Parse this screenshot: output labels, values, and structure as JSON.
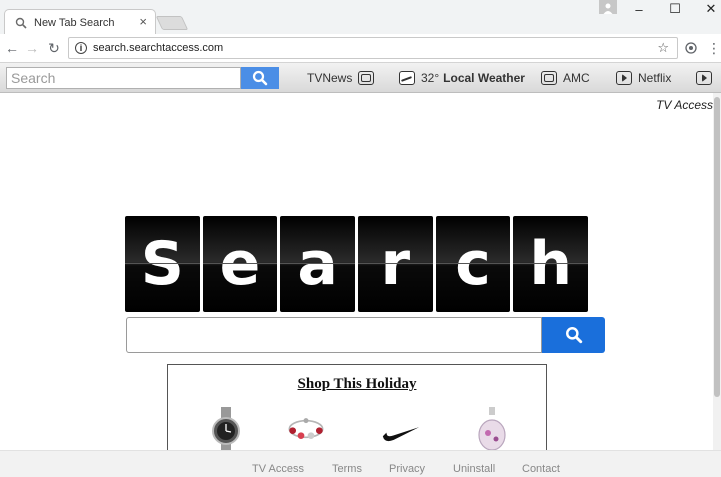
{
  "browser": {
    "tab_title": "New Tab Search",
    "tab_close": "×",
    "url": "search.searchtaccess.com",
    "window": {
      "minimize": "–",
      "maximize": "☐",
      "close": "✕"
    }
  },
  "toolbar": {
    "search_placeholder": "Search",
    "links": {
      "tvnews": "TVNews",
      "weather_temp": "32°",
      "weather_label": "Local Weather",
      "amc": "AMC",
      "netflix": "Netflix"
    }
  },
  "brand": "TV Access",
  "logo_letters": [
    "S",
    "e",
    "a",
    "r",
    "c",
    "h"
  ],
  "promo": {
    "title": "Shop This Holiday"
  },
  "footer": {
    "links": [
      "TV Access",
      "Terms",
      "Privacy",
      "Uninstall",
      "Contact"
    ]
  }
}
